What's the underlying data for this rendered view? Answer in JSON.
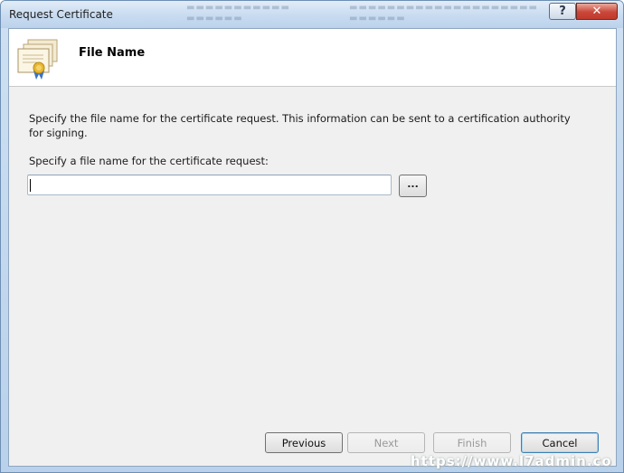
{
  "window": {
    "title": "Request Certificate",
    "help_glyph": "?",
    "close_glyph": "✕"
  },
  "header": {
    "title": "File Name",
    "icon": "certificate-icon"
  },
  "body": {
    "description": "Specify the file name for the certificate request. This information can be sent to a certification authority for signing.",
    "field_label": "Specify a file name for the certificate request:",
    "file_name_value": "",
    "browse_label": "..."
  },
  "footer": {
    "previous_label": "Previous",
    "next_label": "Next",
    "finish_label": "Finish",
    "cancel_label": "Cancel"
  },
  "watermark": "https://www.l7admin.co",
  "colors": {
    "titlebar": "#c8dbf0",
    "client_bg": "#f0f0f0",
    "close_button": "#c9473a"
  }
}
